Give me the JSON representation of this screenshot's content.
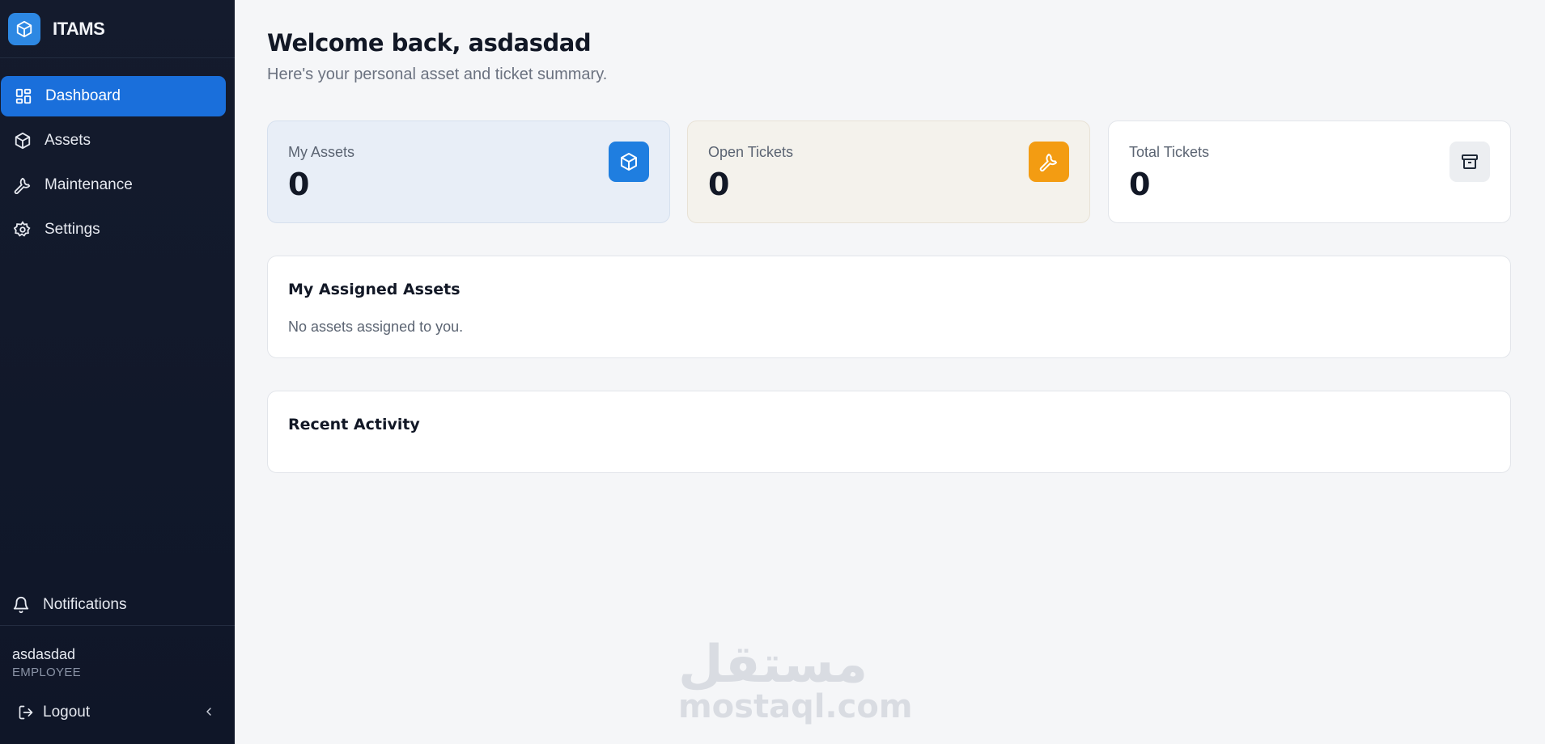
{
  "sidebar": {
    "brand": {
      "name": "ITAMS",
      "icon": "cube-icon",
      "color": "#2d88e3"
    },
    "items": [
      {
        "label": "Dashboard",
        "icon": "dashboard-icon",
        "active": true
      },
      {
        "label": "Assets",
        "icon": "cube-icon",
        "active": false
      },
      {
        "label": "Maintenance",
        "icon": "wrench-icon",
        "active": false
      },
      {
        "label": "Settings",
        "icon": "gear-icon",
        "active": false
      }
    ],
    "notifications_label": "Notifications",
    "user": {
      "name": "asdasdad",
      "role": "EMPLOYEE"
    },
    "logout_label": "Logout",
    "active_color": "#1a6fdb"
  },
  "main": {
    "welcome": "Welcome back, asdasdad",
    "subtitle": "Here's your personal asset and ticket summary.",
    "stats": [
      {
        "label": "My Assets",
        "value": "0",
        "icon": "cube-icon",
        "icon_bg": "#1f7ee0"
      },
      {
        "label": "Open Tickets",
        "value": "0",
        "icon": "wrench-icon",
        "icon_bg": "#f39c12"
      },
      {
        "label": "Total Tickets",
        "value": "0",
        "icon": "archive-icon",
        "icon_bg": "#eceef1"
      }
    ],
    "assigned": {
      "title": "My Assigned Assets",
      "empty_text": "No assets assigned to you."
    },
    "activity": {
      "title": "Recent Activity"
    }
  },
  "watermark": {
    "arabic": "مستقل",
    "latin": "mostaql.com"
  }
}
